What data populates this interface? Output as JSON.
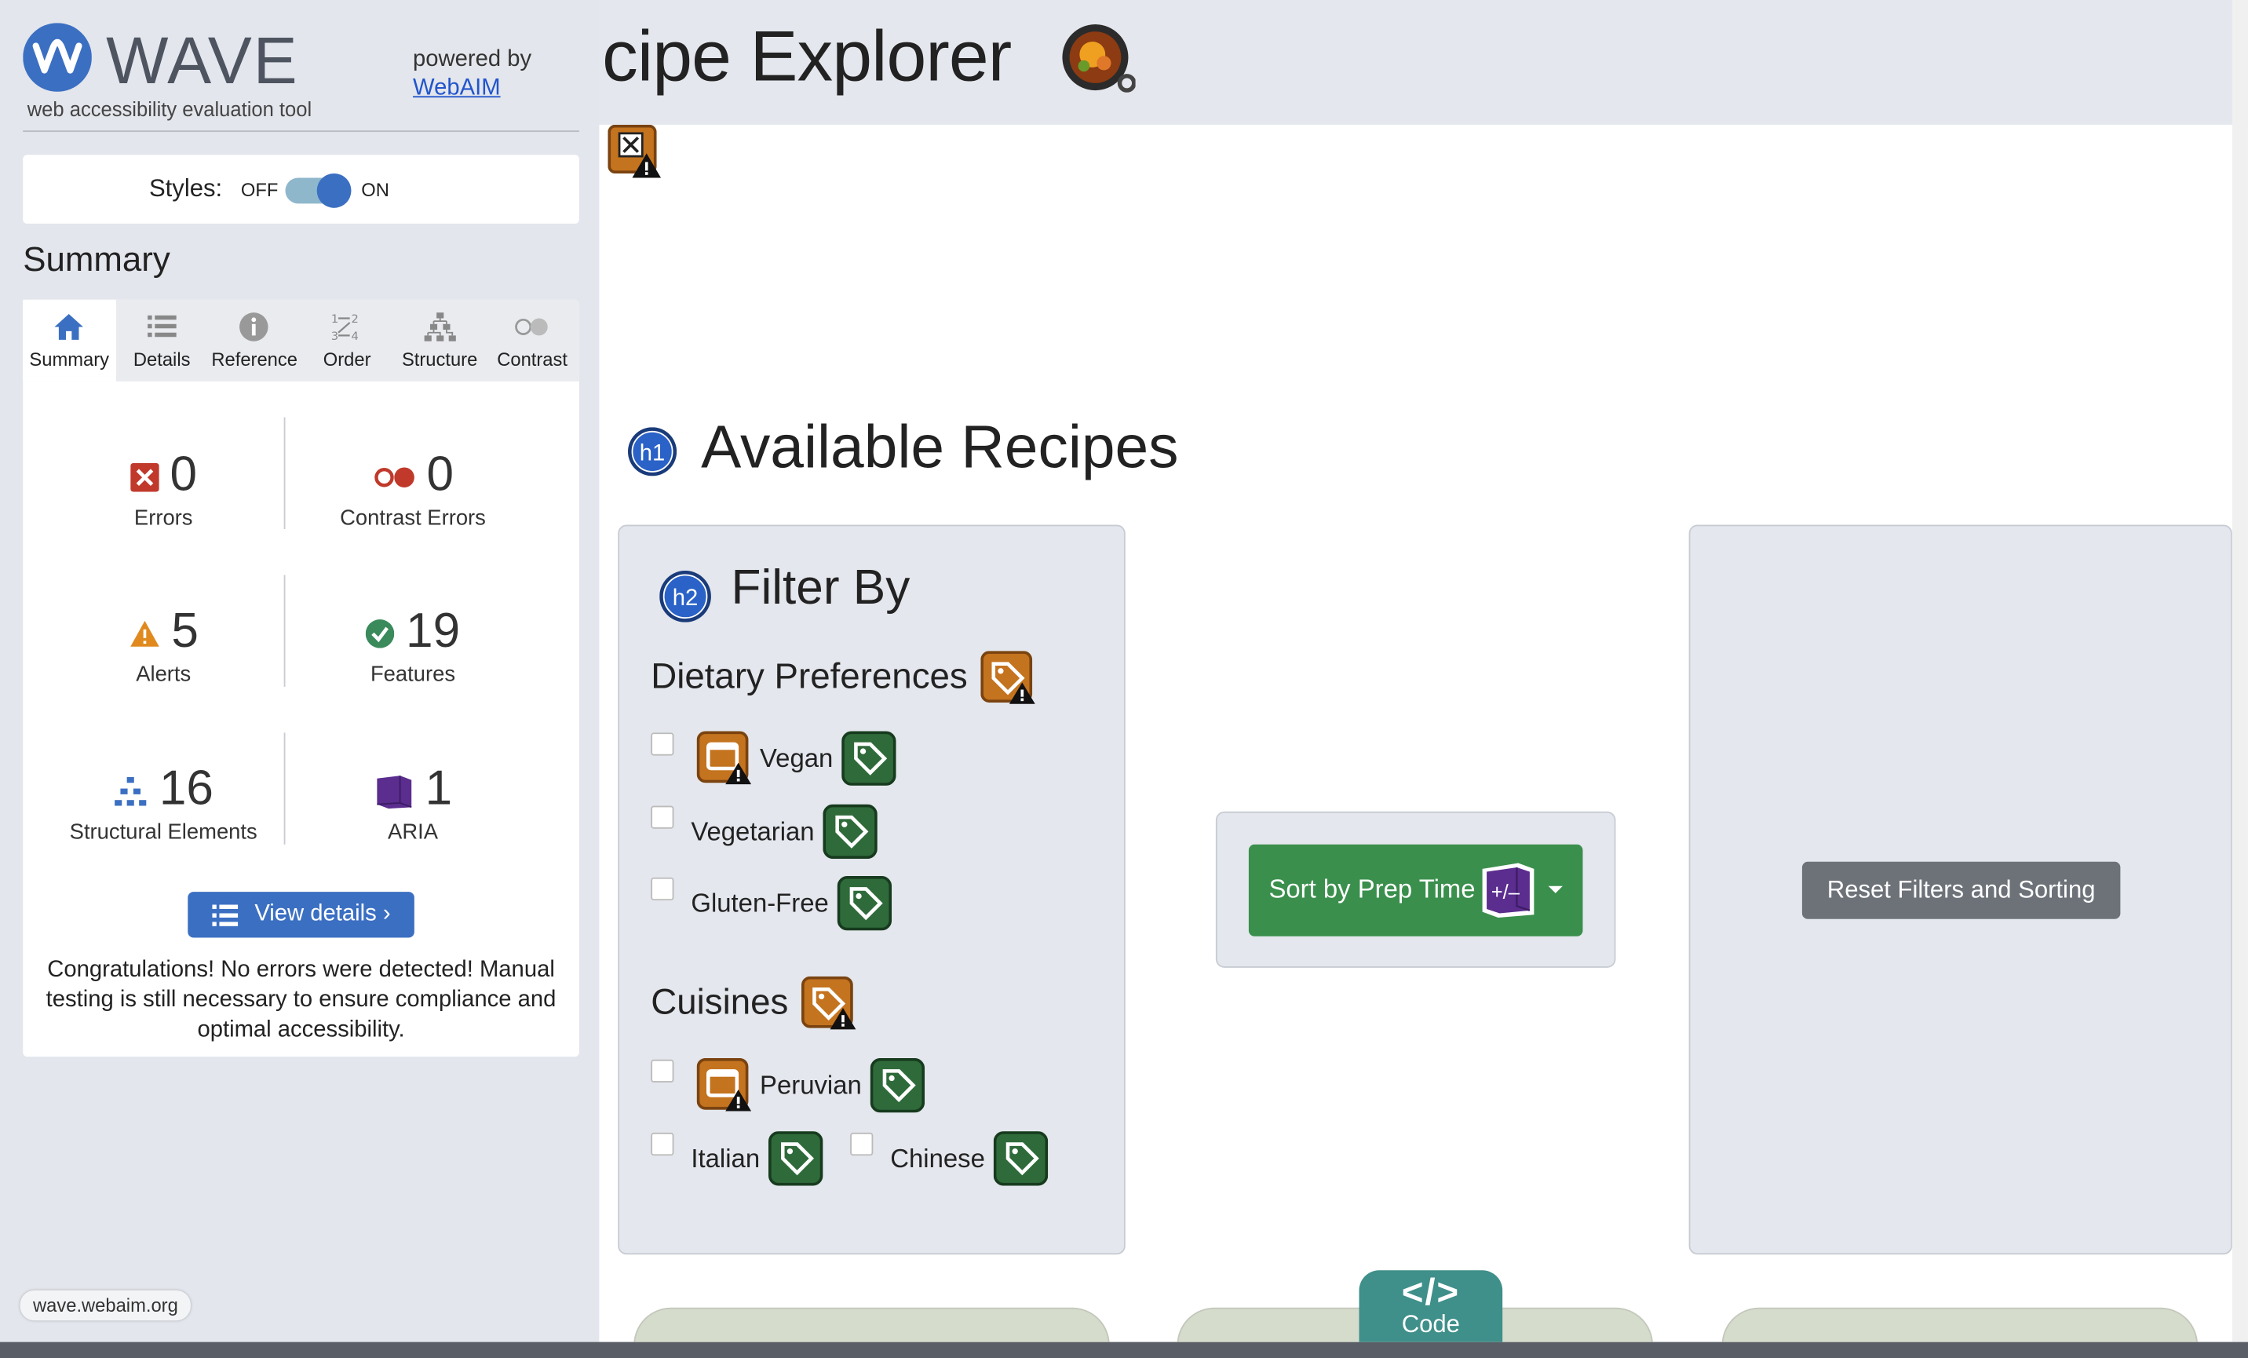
{
  "wave": {
    "logo_text": "WAVE",
    "tagline": "web accessibility evaluation tool",
    "powered_by": "powered by",
    "powered_link": "WebAIM",
    "styles": {
      "label": "Styles:",
      "off": "OFF",
      "on": "ON",
      "state": "on"
    },
    "summary_heading": "Summary",
    "tabs": [
      {
        "label": "Summary",
        "icon": "home-icon",
        "active": true
      },
      {
        "label": "Details",
        "icon": "list-icon",
        "active": false
      },
      {
        "label": "Reference",
        "icon": "info-icon",
        "active": false
      },
      {
        "label": "Order",
        "icon": "order-icon",
        "active": false
      },
      {
        "label": "Structure",
        "icon": "structure-icon",
        "active": false
      },
      {
        "label": "Contrast",
        "icon": "contrast-icon",
        "active": false
      }
    ],
    "stats": {
      "errors": {
        "value": "0",
        "label": "Errors"
      },
      "contrast_errors": {
        "value": "0",
        "label": "Contrast Errors"
      },
      "alerts": {
        "value": "5",
        "label": "Alerts"
      },
      "features": {
        "value": "19",
        "label": "Features"
      },
      "structural": {
        "value": "16",
        "label": "Structural Elements"
      },
      "aria": {
        "value": "1",
        "label": "ARIA"
      }
    },
    "view_details": "View details ›",
    "congrats": "Congratulations! No errors were detected! Manual testing is still necessary to ensure compliance and optimal accessibility.",
    "url": "wave.webaim.org"
  },
  "page": {
    "title": "cipe Explorer",
    "h1_badge": "h1",
    "h1": "Available Recipes",
    "filter": {
      "h2_badge": "h2",
      "heading": "Filter By",
      "dietary_heading": "Dietary Preferences",
      "dietary": [
        "Vegan",
        "Vegetarian",
        "Gluten-Free"
      ],
      "cuisines_heading": "Cuisines",
      "cuisines": [
        "Peruvian",
        "Italian",
        "Chinese"
      ]
    },
    "sort_button": "Sort by Prep Time",
    "aria_badge": "+/–",
    "reset_button": "Reset Filters and Sorting",
    "code_tab": {
      "symbol": "</>",
      "label": "Code"
    }
  },
  "colors": {
    "wave_blue": "#3b6fc2",
    "sidebar_bg": "#e3e6ec",
    "alert_orange": "#c4731f",
    "feature_green": "#2f6b3a",
    "aria_purple": "#5b2d8e",
    "sort_green": "#3a8f4c",
    "reset_gray": "#6d7279",
    "code_teal": "#3f8f8a"
  }
}
